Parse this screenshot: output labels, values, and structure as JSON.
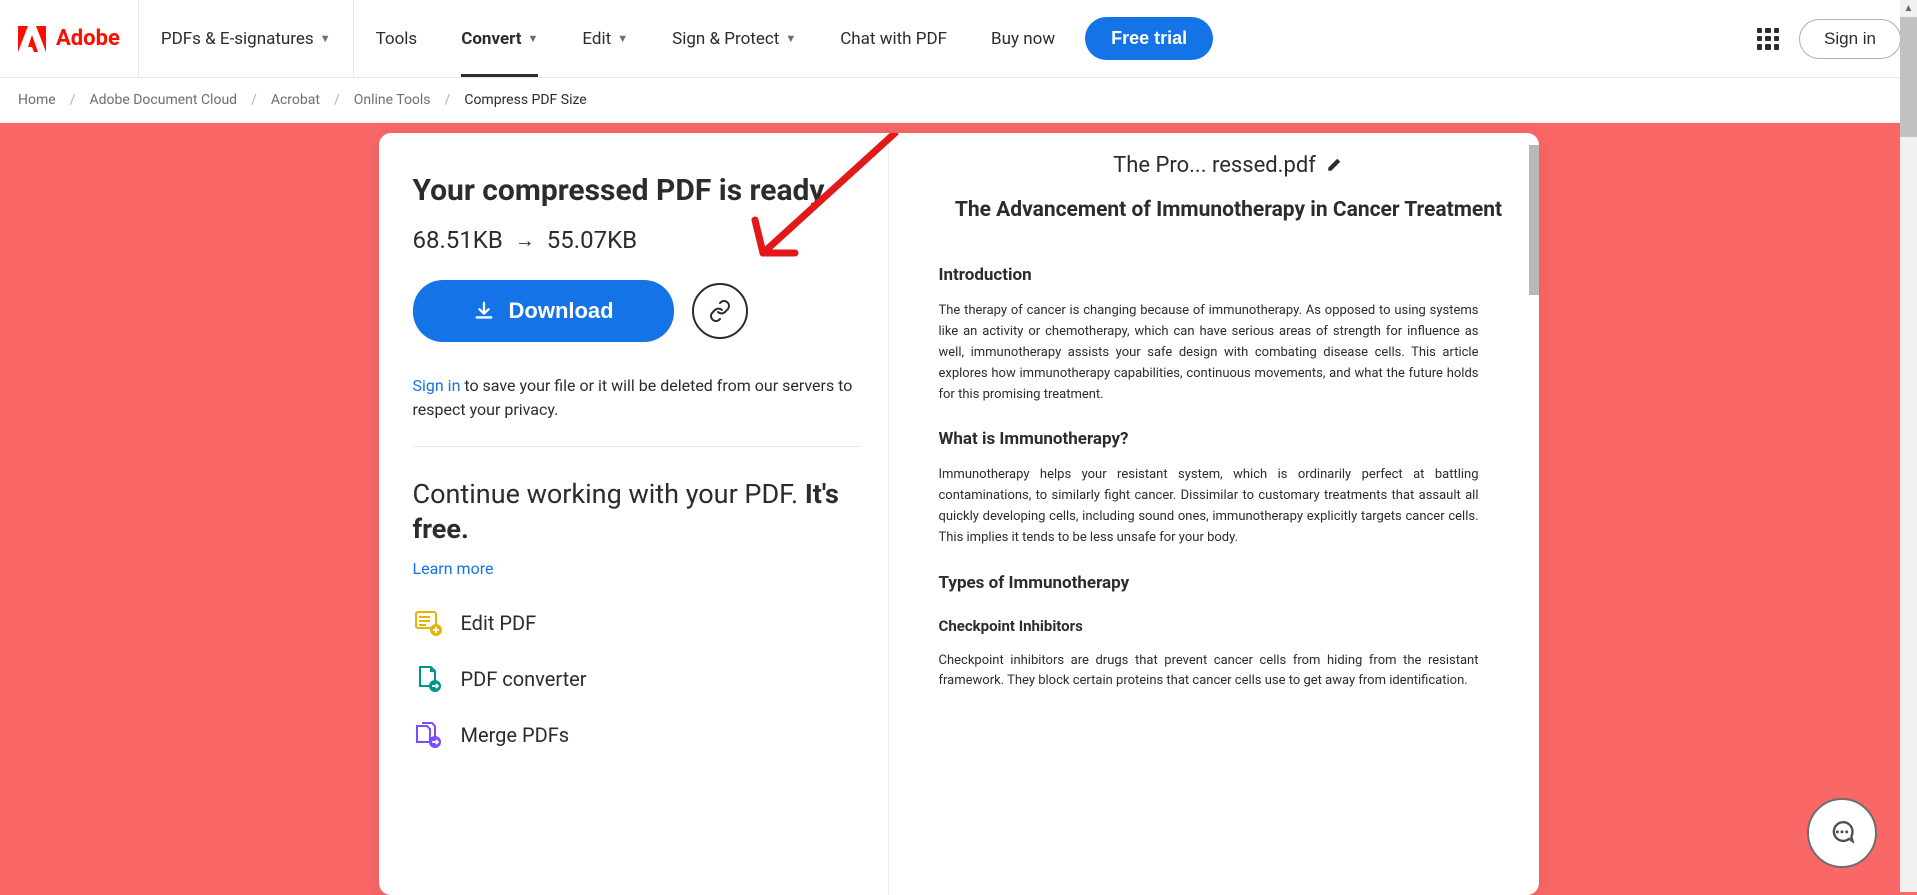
{
  "brand": "Adobe",
  "nav": {
    "pdfs": "PDFs & E-signatures",
    "tools": "Tools",
    "convert": "Convert",
    "edit": "Edit",
    "sign": "Sign & Protect",
    "chat": "Chat with PDF",
    "buy": "Buy now",
    "free_trial": "Free trial",
    "sign_in": "Sign in"
  },
  "breadcrumb": {
    "home": "Home",
    "doc_cloud": "Adobe Document Cloud",
    "acrobat": "Acrobat",
    "online_tools": "Online Tools",
    "current": "Compress PDF Size"
  },
  "result": {
    "title": "Your compressed PDF is ready",
    "size_from": "68.51KB",
    "size_to": "55.07KB",
    "download": "Download",
    "signin_link": "Sign in",
    "signin_rest": " to save your file or it will be deleted from our servers to respect your privacy.",
    "continue_1": "Continue working with your PDF. ",
    "continue_2": "It's free.",
    "learn_more": "Learn more",
    "tools": {
      "edit": "Edit PDF",
      "convert": "PDF converter",
      "merge": "Merge PDFs"
    }
  },
  "preview": {
    "filename": "The Pro... ressed.pdf",
    "doc_title": "The Advancement of Immunotherapy in Cancer Treatment",
    "h1": "Introduction",
    "p1": "The therapy of cancer is changing because of immunotherapy. As opposed to using systems like an activity or chemotherapy, which can have serious areas of strength for influence as well, immunotherapy assists your safe design with combating disease cells. This article explores how immunotherapy capabilities, continuous movements, and what the future holds for this promising treatment.",
    "h2": "What is Immunotherapy?",
    "p2": "Immunotherapy helps your resistant system, which is ordinarily perfect at battling contaminations, to similarly fight cancer. Dissimilar to customary treatments that assault all quickly developing cells, including sound ones, immunotherapy explicitly targets cancer cells. This implies it tends to be less unsafe for your body.",
    "h3": "Types of Immunotherapy",
    "h4": "Checkpoint Inhibitors",
    "p3": "Checkpoint inhibitors are drugs that prevent cancer cells from hiding from the resistant framework. They block certain proteins that cancer cells use to get away from identification."
  }
}
